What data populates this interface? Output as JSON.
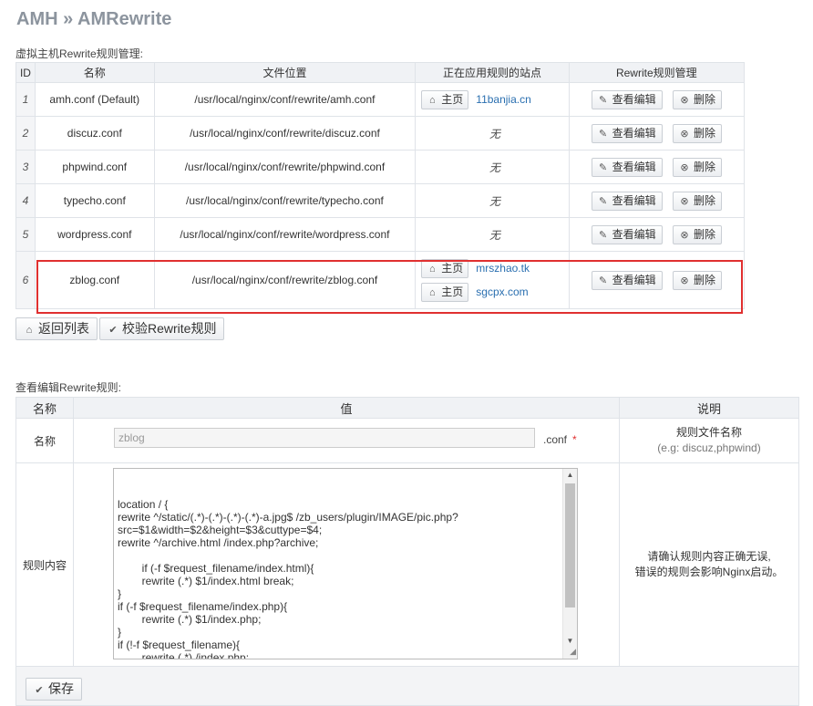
{
  "page": {
    "title": "AMH » AMRewrite"
  },
  "rules_section": {
    "caption": "虚拟主机Rewrite规则管理:",
    "columns": [
      "ID",
      "名称",
      "文件位置",
      "正在应用规则的站点",
      "Rewrite规则管理"
    ],
    "none_text": "无",
    "home_label": "主页",
    "edit_label": "查看编辑",
    "delete_label": "删除",
    "rows": [
      {
        "id": "1",
        "name": "amh.conf  (Default)",
        "path": "/usr/local/nginx/conf/rewrite/amh.conf",
        "sites": [
          "11banjia.cn"
        ]
      },
      {
        "id": "2",
        "name": "discuz.conf",
        "path": "/usr/local/nginx/conf/rewrite/discuz.conf",
        "sites": []
      },
      {
        "id": "3",
        "name": "phpwind.conf",
        "path": "/usr/local/nginx/conf/rewrite/phpwind.conf",
        "sites": []
      },
      {
        "id": "4",
        "name": "typecho.conf",
        "path": "/usr/local/nginx/conf/rewrite/typecho.conf",
        "sites": []
      },
      {
        "id": "5",
        "name": "wordpress.conf",
        "path": "/usr/local/nginx/conf/rewrite/wordpress.conf",
        "sites": []
      },
      {
        "id": "6",
        "name": "zblog.conf",
        "path": "/usr/local/nginx/conf/rewrite/zblog.conf",
        "sites": [
          "mrszhao.tk",
          "sgcpx.com"
        ]
      }
    ]
  },
  "actions": {
    "back_label": "返回列表",
    "verify_label": "校验Rewrite规则"
  },
  "editor": {
    "caption": "查看编辑Rewrite规则:",
    "columns": [
      "名称",
      "值",
      "说明"
    ],
    "name_label": "名称",
    "name_value": "zblog",
    "name_suffix": ".conf",
    "required_mark": "*",
    "name_hint_1": "规则文件名称",
    "name_hint_2": "(e.g: discuz,phpwind)",
    "content_label": "规则内容",
    "content_value": "location / {\nrewrite ^/static/(.*)-(.*)-(.*)-(.*)-a.jpg$ /zb_users/plugin/IMAGE/pic.php?\nsrc=$1&width=$2&height=$3&cuttype=$4;\nrewrite ^/archive.html /index.php?archive;\n\n        if (-f $request_filename/index.html){\n        rewrite (.*) $1/index.html break;\n}\nif (-f $request_filename/index.php){\n        rewrite (.*) $1/index.php;\n}\nif (!-f $request_filename){\n        rewrite (.*) /index.php;\n}",
    "content_hint_1": "请确认规则内容正确无误,",
    "content_hint_2": "错误的规则会影响Nginx启动。",
    "save_label": "保存"
  },
  "icons": {
    "home": "home-icon",
    "edit": "pencil-icon",
    "delete": "circle-x-icon",
    "back": "home-icon",
    "verify": "check-icon",
    "save": "check-icon"
  },
  "colors": {
    "highlight_border": "#e03030",
    "link": "#2a6fb0",
    "title": "#8c949e"
  }
}
